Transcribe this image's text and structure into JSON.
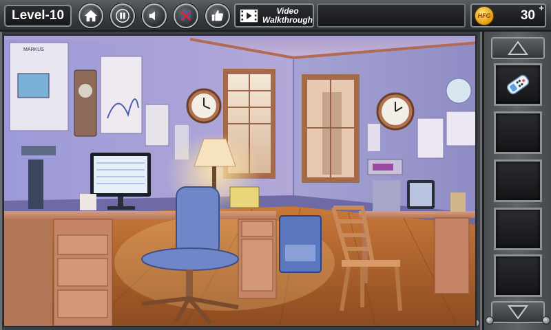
{
  "topbar": {
    "level_label": "Level-10",
    "video_label_line1": "Video",
    "video_label_line2": "Walkthrough",
    "coin_logo_text": "HFG",
    "coin_count": "30",
    "plus_symbol": "+",
    "buttons": [
      {
        "name": "home-button",
        "icon": "home-icon"
      },
      {
        "name": "pause-button",
        "icon": "pause-icon"
      },
      {
        "name": "sound-button",
        "icon": "speaker-icon"
      },
      {
        "name": "music-button",
        "icon": "music-muted-icon"
      },
      {
        "name": "like-button",
        "icon": "thumbs-up-icon"
      }
    ]
  },
  "scene": {
    "description_icon": "study-room-scene",
    "poster_text": "MARKUS"
  },
  "inventory": {
    "slots": [
      {
        "item": "remote-control",
        "filled": true
      },
      {
        "item": "",
        "filled": false
      },
      {
        "item": "",
        "filled": false
      },
      {
        "item": "",
        "filled": false
      },
      {
        "item": "",
        "filled": false
      }
    ]
  },
  "colors": {
    "accent_gold": "#f0a01a",
    "panel_grey": "#4a4d51",
    "wall_blue": "#8f8fd0",
    "floor_wood": "#b8662e"
  }
}
